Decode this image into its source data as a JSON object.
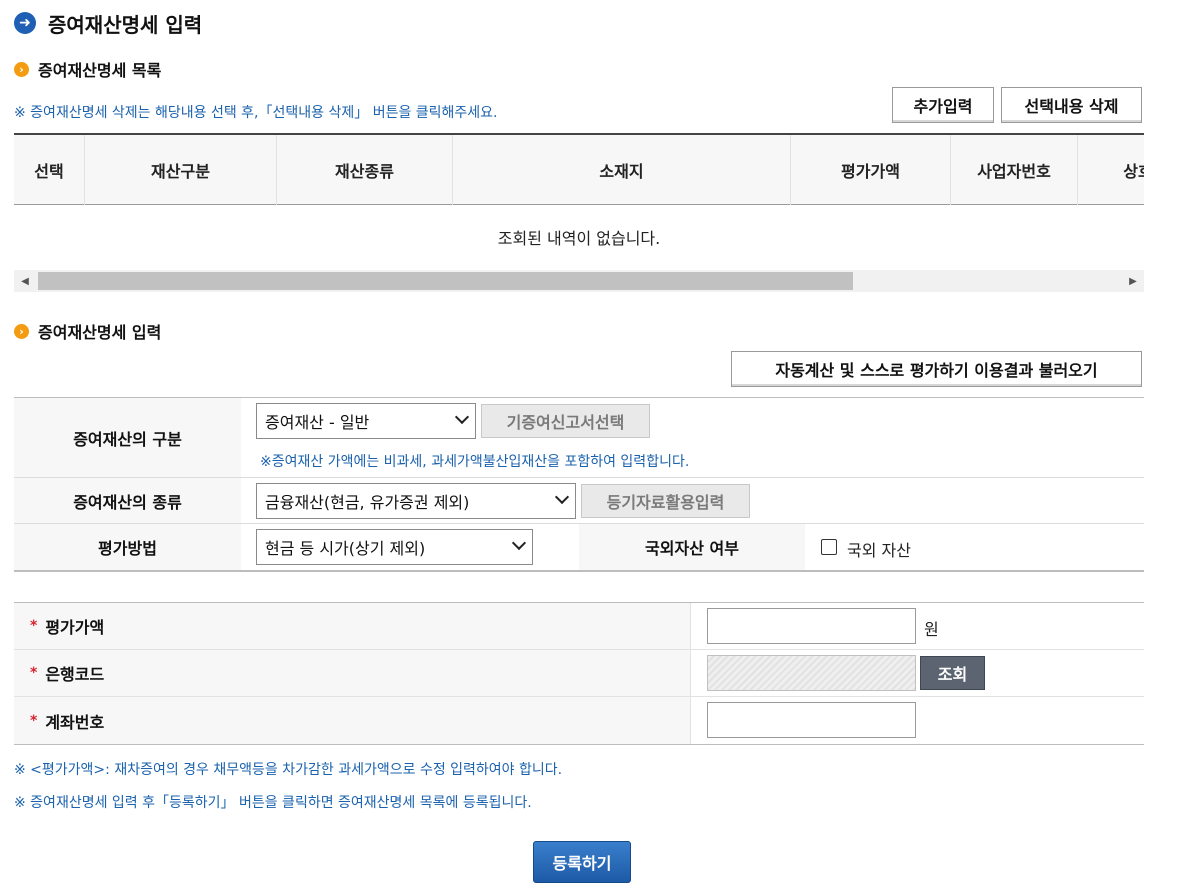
{
  "page_title": "증여재산명세 입력",
  "list_section": {
    "title": "증여재산명세 목록",
    "note": "※ 증여재산명세 삭제는 해당내용 선택 후,「선택내용 삭제」 버튼을 클릭해주세요.",
    "add_button": "추가입력",
    "delete_button": "선택내용 삭제",
    "columns": [
      "선택",
      "재산구분",
      "재산종류",
      "소재지",
      "평가가액",
      "사업자번호",
      "상호"
    ],
    "empty_message": "조회된 내역이 없습니다."
  },
  "input_section": {
    "title": "증여재산명세 입력",
    "load_button": "자동계산 및 스스로 평가하기 이용결과 불러오기",
    "rows": {
      "category": {
        "label": "증여재산의 구분",
        "select_value": "증여재산 - 일반",
        "button": "기증여신고서선택",
        "note": "※증여재산 가액에는 비과세, 과세가액불산입재산을 포함하여 입력합니다."
      },
      "type": {
        "label": "증여재산의 종류",
        "select_value": "금융재산(현금, 유가증권 제외)",
        "button": "등기자료활용입력"
      },
      "method": {
        "label": "평가방법",
        "select_value": "현금 등 시가(상기 제외)",
        "overseas_label": "국외자산 여부",
        "overseas_checkbox_label": "국외 자산",
        "overseas_checked": false
      }
    }
  },
  "amount_section": {
    "required_mark": "*",
    "fields": {
      "value": {
        "label": "평가가액",
        "value": "",
        "unit": "원"
      },
      "bank_code": {
        "label": "은행코드",
        "value": "",
        "button": "조회"
      },
      "account": {
        "label": "계좌번호",
        "value": ""
      }
    }
  },
  "footer_notes": [
    "※ <평가가액>: 재차증여의 경우 채무액등을 차가감한 과세가액으로 수정 입력하여야 합니다.",
    "※ 증여재산명세 입력 후「등록하기」 버튼을 클릭하면 증여재산명세 목록에 등록됩니다."
  ],
  "register_button": "등록하기",
  "colors": {
    "accent_blue": "#1f5fb4",
    "note_blue": "#1b62ae",
    "section_icon_orange": "#f39c12",
    "required_red": "#d9232e",
    "dark_button": "#5b6470"
  },
  "icons": {
    "title": "arrow-right-circle-icon",
    "section": "chevron-right-circle-icon"
  }
}
